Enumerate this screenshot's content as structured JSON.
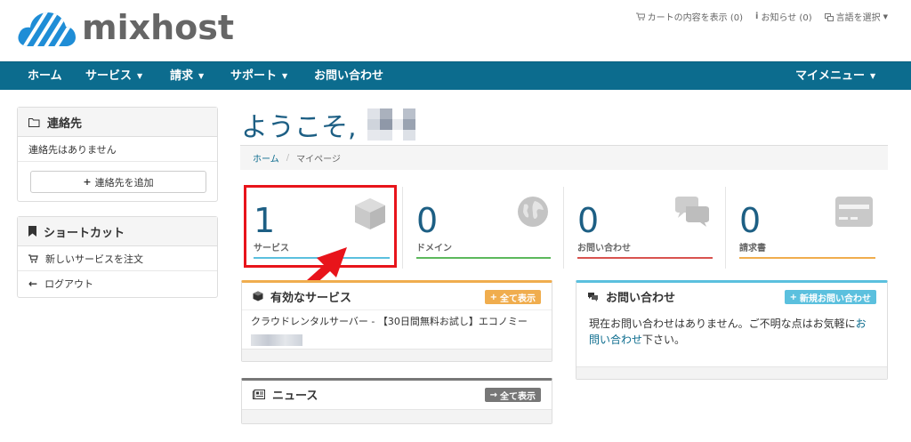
{
  "brand": {
    "name": "mixhost"
  },
  "toplinks": [
    {
      "icon": "cart-icon",
      "label": "カートの内容を表示 (0)"
    },
    {
      "icon": "info-icon",
      "label": "お知らせ (0)"
    },
    {
      "icon": "language-icon",
      "label": "言語を選択"
    }
  ],
  "nav": {
    "items": [
      "ホーム",
      "サービス",
      "請求",
      "サポート",
      "お問い合わせ"
    ],
    "right": "マイメニュー"
  },
  "sidebar": {
    "contacts": {
      "title": "連絡先",
      "empty": "連絡先はありません",
      "add_button": "連絡先を追加"
    },
    "shortcuts": {
      "title": "ショートカット",
      "items": [
        "新しいサービスを注文",
        "ログアウト"
      ]
    }
  },
  "welcome": {
    "text": "ようこそ,"
  },
  "breadcrumb": {
    "home": "ホーム",
    "sep": "/",
    "current": "マイページ"
  },
  "tiles": [
    {
      "count": "1",
      "label": "サービス",
      "color": "#5bc0de"
    },
    {
      "count": "0",
      "label": "ドメイン",
      "color": "#5cb85c"
    },
    {
      "count": "0",
      "label": "お問い合わせ",
      "color": "#d9534f"
    },
    {
      "count": "0",
      "label": "請求書",
      "color": "#f0ad4e"
    }
  ],
  "services_card": {
    "title": "有効なサービス",
    "button": "全て表示",
    "accent": "#f0ad4e",
    "item": "クラウドレンタルサーバー - 【30日間無料お試し】エコノミー"
  },
  "support_card": {
    "title": "お問い合わせ",
    "button": "新規お問い合わせ",
    "accent": "#5bc0de",
    "text_before": "現在お問い合わせはありません。ご不明な点はお気軽に",
    "link": "お問い合わせ",
    "text_after": "下さい。"
  },
  "news_card": {
    "title": "ニュース",
    "button": "全て表示",
    "accent": "#777"
  }
}
